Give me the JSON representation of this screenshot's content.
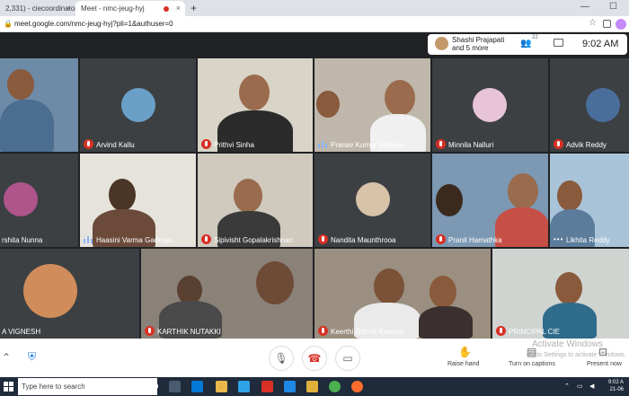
{
  "browser": {
    "tabs": [
      {
        "label": "2,331) - ciecoordinator@"
      },
      {
        "label": "Meet - nmc-jeug-hyj"
      }
    ],
    "new_tab": "+",
    "window_controls": [
      "—",
      "☐"
    ],
    "url": "meet.google.com/nmc-jeug-hyj?pli=1&authuser=0"
  },
  "meet": {
    "host_name": "Shashi Prajapati",
    "host_more": "and 5 more",
    "people_count": "22",
    "time": "9:02 AM",
    "participants": [
      {
        "name": "",
        "status": "none"
      },
      {
        "name": "Arvind Kallu",
        "status": "muted"
      },
      {
        "name": "Prithvi Sinha",
        "status": "muted"
      },
      {
        "name": "Pranav Kumar Vijaiyan",
        "status": "speaking"
      },
      {
        "name": "Minnila Nalluri",
        "status": "muted"
      },
      {
        "name": "Advik Reddy",
        "status": "muted"
      },
      {
        "name": "rshita Nunna",
        "status": "none"
      },
      {
        "name": "Haasini Varma Gadiraju",
        "status": "speaking"
      },
      {
        "name": "Sipivisht Gopalakrishnan",
        "status": "muted"
      },
      {
        "name": "Nandita Maunthrooa",
        "status": "muted"
      },
      {
        "name": "Pranit Hamathka",
        "status": "muted"
      },
      {
        "name": "Likhita Reddy",
        "status": "dots"
      },
      {
        "name": "A VIGNESH",
        "status": "none"
      },
      {
        "name": "KARTHIK NUTAKKI",
        "status": "muted"
      },
      {
        "name": "Keerthi Rithvik Kanduri",
        "status": "muted"
      },
      {
        "name": "PRINCIPAL CIE",
        "status": "muted"
      }
    ]
  },
  "controls": {
    "raise_hand": "Raise hand",
    "captions": "Turn on captions",
    "present": "Present now",
    "activate_title": "Activate Windows",
    "activate_sub": "Go to Settings to activate Windows."
  },
  "taskbar": {
    "search_placeholder": "Type here to search",
    "clock_time": "9:02 A",
    "clock_date": "21-06"
  }
}
